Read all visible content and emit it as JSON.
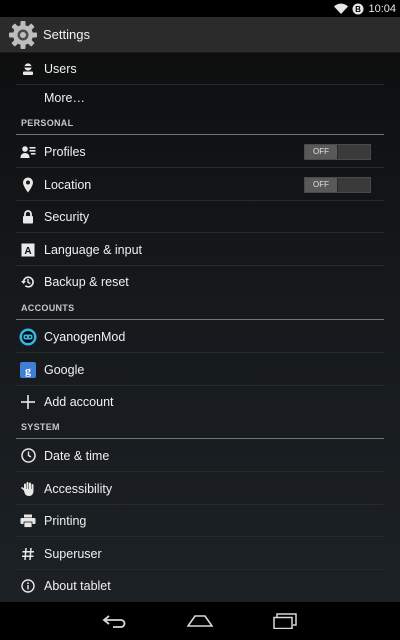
{
  "status_bar": {
    "time": "10:04",
    "icons": [
      "wifi-icon",
      "sync-badge-icon"
    ]
  },
  "action_bar": {
    "title": "Settings",
    "icon": "settings-gear-icon"
  },
  "top_items": [
    {
      "label": "Users",
      "icon": "user-icon"
    },
    {
      "label": "More…",
      "icon": ""
    }
  ],
  "sections": [
    {
      "header": "PERSONAL",
      "items": [
        {
          "label": "Profiles",
          "icon": "profiles-icon",
          "toggle": "OFF"
        },
        {
          "label": "Location",
          "icon": "location-pin-icon",
          "toggle": "OFF"
        },
        {
          "label": "Security",
          "icon": "lock-icon"
        },
        {
          "label": "Language & input",
          "icon": "keyboard-a-icon"
        },
        {
          "label": "Backup & reset",
          "icon": "backup-restore-icon"
        }
      ]
    },
    {
      "header": "ACCOUNTS",
      "items": [
        {
          "label": "CyanogenMod",
          "icon": "cyanogenmod-icon"
        },
        {
          "label": "Google",
          "icon": "google-icon"
        },
        {
          "label": "Add account",
          "icon": "plus-icon"
        }
      ]
    },
    {
      "header": "SYSTEM",
      "items": [
        {
          "label": "Date & time",
          "icon": "clock-icon"
        },
        {
          "label": "Accessibility",
          "icon": "hand-icon"
        },
        {
          "label": "Printing",
          "icon": "printer-icon"
        },
        {
          "label": "Superuser",
          "icon": "hash-icon"
        },
        {
          "label": "About tablet",
          "icon": "info-icon"
        }
      ]
    }
  ],
  "nav_bar": {
    "buttons": [
      "back-icon",
      "home-icon",
      "recents-icon"
    ]
  },
  "colors": {
    "accent": "#33b5e5",
    "text": "#f0f0f0",
    "header_text": "#c7c7c7"
  }
}
